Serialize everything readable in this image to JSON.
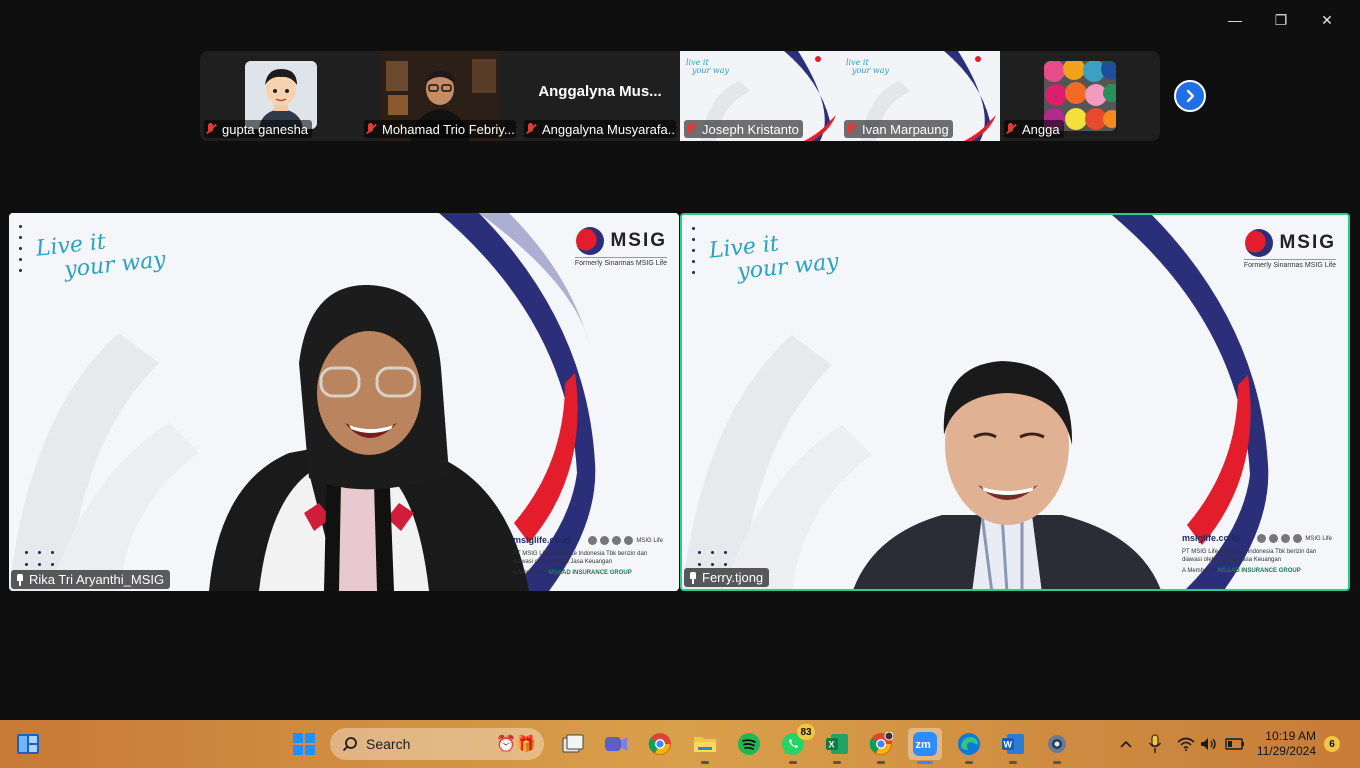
{
  "window": {
    "controls": {
      "minimize": "—",
      "restore": "❐",
      "close": "✕"
    }
  },
  "thumbnails": [
    {
      "name": "gupta ganesha",
      "kind": "avatar"
    },
    {
      "name": "Mohamad Trio Febriy...",
      "kind": "video"
    },
    {
      "name": "Anggalyna Musyarafa...",
      "kind": "name-only",
      "display_name": "Anggalyna  Mus..."
    },
    {
      "name": "Joseph Kristanto",
      "kind": "slide"
    },
    {
      "name": "Ivan Marpaung",
      "kind": "slide"
    },
    {
      "name": "Angga",
      "kind": "yarn"
    }
  ],
  "next_button": "next-page",
  "speakers": [
    {
      "name": "Rika Tri Aryanthi_MSIG"
    },
    {
      "name": "Ferry.tjong"
    }
  ],
  "slide": {
    "tagline_line1": "Live it",
    "tagline_line2": "your way",
    "brand": "MSIG",
    "brand_sub": "Formerly Sinarmas MSIG Life",
    "site": "msiglife.co.id",
    "small_brand": "MSIG Life",
    "legal": "PT MSIG Life Insurance Indonesia Tbk berizin dan diawasi oleh Otoritas Jasa Keuangan",
    "member_prefix": "A Member of",
    "group": "MS&AD INSURANCE GROUP"
  },
  "colors": {
    "active_speaker_border": "#23d18b",
    "accent_blue": "#1f6fe6",
    "mute_red": "#e03a3a"
  },
  "taskbar": {
    "search_placeholder": "Search",
    "whatsapp_badge": "83",
    "time": "10:19 AM",
    "date": "11/29/2024",
    "notifications": "6"
  }
}
